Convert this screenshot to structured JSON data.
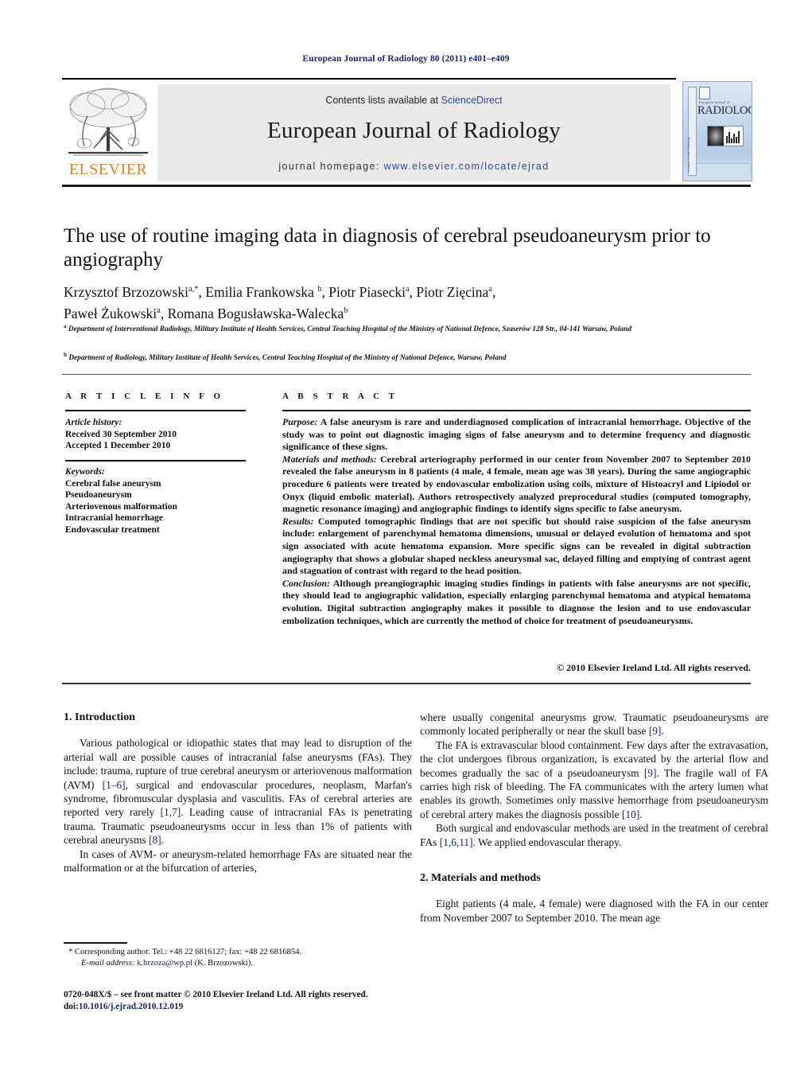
{
  "running_head": "European Journal of Radiology 80 (2011) e401–e409",
  "masthead": {
    "contents_prefix": "Contents lists available at ",
    "contents_link": "ScienceDirect",
    "journal_name": "European Journal of Radiology",
    "homepage_prefix": "journal homepage: ",
    "homepage_url": "www.elsevier.com/locate/ejrad",
    "publisher_logo_text": "ELSEVIER",
    "cover": {
      "superline": "European Journal of",
      "title": "RADIOLOGY",
      "spine": "European Journal of Radiology"
    }
  },
  "article": {
    "title": "The use of routine imaging data in diagnosis of cerebral pseudoaneurysm prior to angiography",
    "authors_line_1": "Krzysztof Brzozowski",
    "authors": [
      {
        "name": "Krzysztof Brzozowski",
        "marks": "a,*"
      },
      {
        "name": "Emilia Frankowska",
        "marks": "b"
      },
      {
        "name": "Piotr Piasecki",
        "marks": "a"
      },
      {
        "name": "Piotr Zięcina",
        "marks": "a"
      },
      {
        "name": "Paweł Żukowski",
        "marks": "a"
      },
      {
        "name": "Romana Bogusławska-Walecka",
        "marks": "b"
      }
    ],
    "affiliations": [
      {
        "mark": "a",
        "text": "Department of Interventional Radiology, Military Institute of Health Services, Central Teaching Hospital of the Ministry of National Defence, Szaserów 128 Str., 04-141 Warsaw, Poland"
      },
      {
        "mark": "b",
        "text": "Department of Radiology, Military Institute of Health Services, Central Teaching Hospital of the Ministry of National Defence, Warsaw, Poland"
      }
    ]
  },
  "article_info": {
    "heading": "A R T I C L E    I N F O",
    "history_label": "Article history:",
    "history": [
      "Received 30 September 2010",
      "Accepted 1 December 2010"
    ],
    "keywords_label": "Keywords:",
    "keywords": [
      "Cerebral false aneurysm",
      "Pseudoaneurysm",
      "Arteriovenous malformation",
      "Intracranial hemorrhage",
      "Endovascular treatment"
    ]
  },
  "abstract": {
    "heading": "A B S T R A C T",
    "sections": [
      {
        "label": "Purpose:",
        "text": " A false aneurysm is rare and underdiagnosed complication of intracranial hemorrhage. Objective of the study was to point out diagnostic imaging signs of false aneurysm and to determine frequency and diagnostic significance of these signs."
      },
      {
        "label": "Materials and methods:",
        "text": " Cerebral arteriography performed in our center from November 2007 to September 2010 revealed the false aneurysm in 8 patients (4 male, 4 female, mean age was 38 years). During the same angiographic procedure 6 patients were treated by endovascular embolization using coils, mixture of Histoacryl and Lipiodol or Onyx (liquid embolic material). Authors retrospectively analyzed preprocedural studies (computed tomography, magnetic resonance imaging) and angiographic findings to identify signs specific to false aneurysm."
      },
      {
        "label": "Results:",
        "text": " Computed tomographic findings that are not specific but should raise suspicion of the false aneurysm include: enlargement of parenchymal hematoma dimensions, unusual or delayed evolution of hematoma and spot sign associated with acute hematoma expansion. More specific signs can be revealed in digital subtraction angiography that shows a globular shaped neckless aneurysmal sac, delayed filling and emptying of contrast agent and stagnation of contrast with regard to the head position."
      },
      {
        "label": "Conclusion:",
        "text": " Although preangiographic imaging studies findings in patients with false aneurysms are not specific, they should lead to angiographic validation, especially enlarging parenchymal hematoma and atypical hematoma evolution. Digital subtraction angiography makes it possible to diagnose the lesion and to use endovascular embolization techniques, which are currently the method of choice for treatment of pseudoaneurysms."
      }
    ],
    "copyright": "© 2010 Elsevier Ireland Ltd. All rights reserved."
  },
  "body": {
    "left_column": {
      "heading": "1.  Introduction",
      "paragraph_1_a": "Various pathological or idiopathic states that may lead to disruption of the arterial wall are possible causes of intracranial false aneurysms (FAs). They include: trauma, rupture of true cerebral aneurysm or arteriovenous malformation (AVM) ",
      "ref_1_6": "[1–6]",
      "paragraph_1_b": ", surgical and endovascular procedures, neoplasm, Marfan's syndrome, fibromuscular dysplasia and vasculitis. FAs of cerebral arteries are reported very rarely ",
      "ref_1_7": "[1,7]",
      "paragraph_1_c": ". Leading cause of intracranial FAs is penetrating trauma. Traumatic pseudoaneurysms occur in less than 1% of patients with cerebral aneurysms ",
      "ref_8": "[8]",
      "paragraph_1_d": ".",
      "paragraph_2": "In cases of AVM- or aneurysm-related hemorrhage FAs are situated near the malformation or at the bifurcation of arteries,"
    },
    "right_column": {
      "paragraph_1_a": "where usually congenital aneurysms grow. Traumatic pseudoaneurysms are commonly located peripherally or near the skull base ",
      "ref_9a": "[9]",
      "paragraph_1_b": ".",
      "paragraph_2_a": "The FA is extravascular blood containment. Few days after the extravasation, the clot undergoes fibrous organization, is excavated by the arterial flow and becomes gradually the sac of a pseudoaneurysm ",
      "ref_9b": "[9]",
      "paragraph_2_b": ". The fragile wall of FA carries high risk of bleeding. The FA communicates with the artery lumen what enables its growth. Sometimes only massive hemorrhage from pseudoaneurysm of cerebral artery makes the diagnosis possible ",
      "ref_10": "[10]",
      "paragraph_2_c": ".",
      "paragraph_3_a": "Both surgical and endovascular methods are used in the treatment of cerebral FAs ",
      "ref_1_6_11": "[1,6,11]",
      "paragraph_3_b": ". We applied endovascular therapy.",
      "heading_2": "2.  Materials and methods",
      "paragraph_4": "Eight patients (4 male, 4 female) were diagnosed with the FA in our center from November 2007 to September 2010. The mean age"
    }
  },
  "footer": {
    "corresponding": "* Corresponding author. Tel.: +48 22 6816127; fax: +48 22 6816854.",
    "email_label": "E-mail address:",
    "email": "k.brzoza@wp.pl",
    "email_owner": "(K. Brzozowski).",
    "frontmatter": "0720-048X/$ – see front matter © 2010 Elsevier Ireland Ltd. All rights reserved.",
    "doi_label": "doi:",
    "doi": "10.1016/j.ejrad.2010.12.019"
  },
  "colors": {
    "link_blue": "#2b4a9b",
    "ref_navy": "#14276b",
    "elsevier_orange": "#ef7f1a",
    "masthead_grey": "#e9e9e9"
  }
}
